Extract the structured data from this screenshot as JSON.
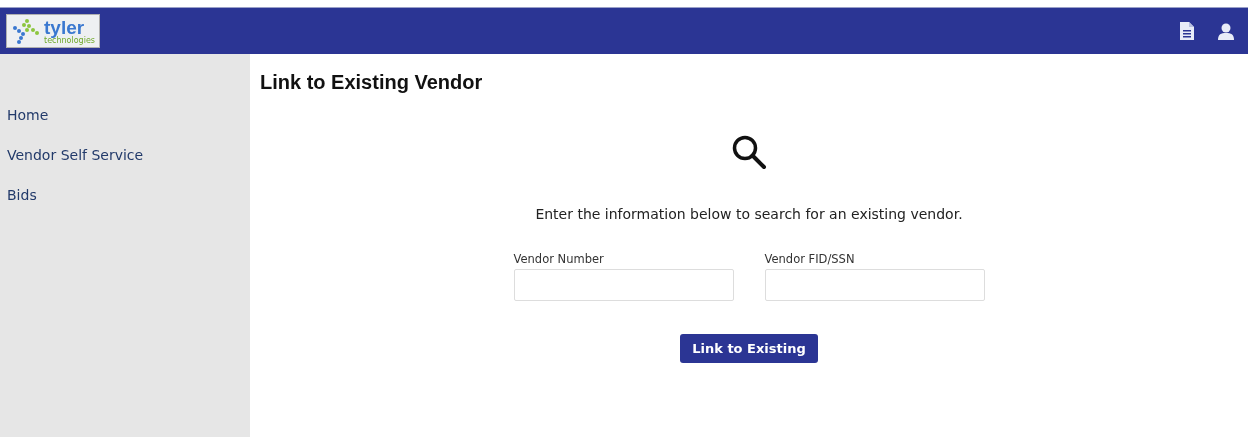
{
  "header": {
    "logo": {
      "name": "tyler",
      "tagline": "technologies"
    }
  },
  "sidebar": {
    "items": [
      {
        "label": "Home"
      },
      {
        "label": "Vendor Self Service"
      },
      {
        "label": "Bids"
      }
    ]
  },
  "page": {
    "title": "Link to Existing Vendor",
    "instructions": "Enter the information below to search for an existing vendor.",
    "fields": [
      {
        "label": "Vendor Number"
      },
      {
        "label": "Vendor FID/SSN"
      }
    ],
    "button": "Link to Existing"
  }
}
